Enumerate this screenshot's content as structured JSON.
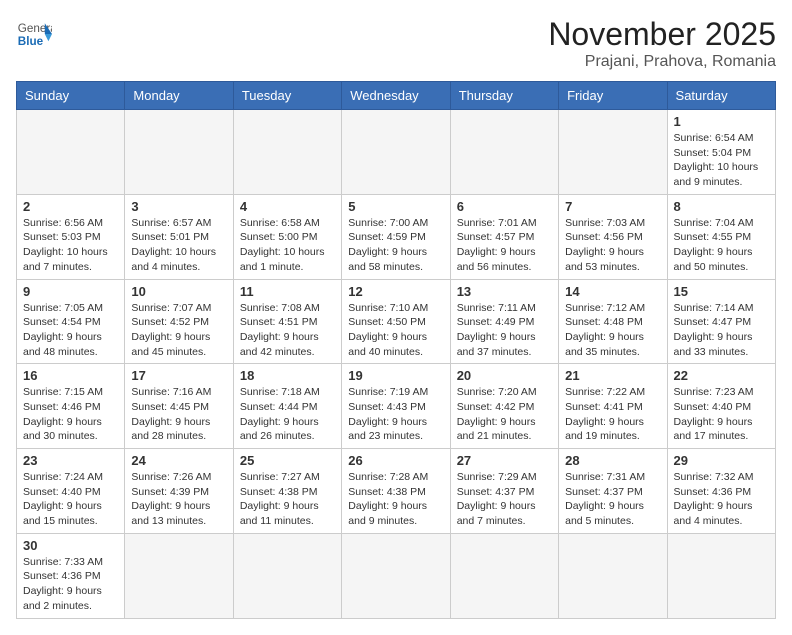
{
  "header": {
    "logo_general": "General",
    "logo_blue": "Blue",
    "month_title": "November 2025",
    "location": "Prajani, Prahova, Romania"
  },
  "weekdays": [
    "Sunday",
    "Monday",
    "Tuesday",
    "Wednesday",
    "Thursday",
    "Friday",
    "Saturday"
  ],
  "weeks": [
    [
      {
        "day": "",
        "info": ""
      },
      {
        "day": "",
        "info": ""
      },
      {
        "day": "",
        "info": ""
      },
      {
        "day": "",
        "info": ""
      },
      {
        "day": "",
        "info": ""
      },
      {
        "day": "",
        "info": ""
      },
      {
        "day": "1",
        "info": "Sunrise: 6:54 AM\nSunset: 5:04 PM\nDaylight: 10 hours and 9 minutes."
      }
    ],
    [
      {
        "day": "2",
        "info": "Sunrise: 6:56 AM\nSunset: 5:03 PM\nDaylight: 10 hours and 7 minutes."
      },
      {
        "day": "3",
        "info": "Sunrise: 6:57 AM\nSunset: 5:01 PM\nDaylight: 10 hours and 4 minutes."
      },
      {
        "day": "4",
        "info": "Sunrise: 6:58 AM\nSunset: 5:00 PM\nDaylight: 10 hours and 1 minute."
      },
      {
        "day": "5",
        "info": "Sunrise: 7:00 AM\nSunset: 4:59 PM\nDaylight: 9 hours and 58 minutes."
      },
      {
        "day": "6",
        "info": "Sunrise: 7:01 AM\nSunset: 4:57 PM\nDaylight: 9 hours and 56 minutes."
      },
      {
        "day": "7",
        "info": "Sunrise: 7:03 AM\nSunset: 4:56 PM\nDaylight: 9 hours and 53 minutes."
      },
      {
        "day": "8",
        "info": "Sunrise: 7:04 AM\nSunset: 4:55 PM\nDaylight: 9 hours and 50 minutes."
      }
    ],
    [
      {
        "day": "9",
        "info": "Sunrise: 7:05 AM\nSunset: 4:54 PM\nDaylight: 9 hours and 48 minutes."
      },
      {
        "day": "10",
        "info": "Sunrise: 7:07 AM\nSunset: 4:52 PM\nDaylight: 9 hours and 45 minutes."
      },
      {
        "day": "11",
        "info": "Sunrise: 7:08 AM\nSunset: 4:51 PM\nDaylight: 9 hours and 42 minutes."
      },
      {
        "day": "12",
        "info": "Sunrise: 7:10 AM\nSunset: 4:50 PM\nDaylight: 9 hours and 40 minutes."
      },
      {
        "day": "13",
        "info": "Sunrise: 7:11 AM\nSunset: 4:49 PM\nDaylight: 9 hours and 37 minutes."
      },
      {
        "day": "14",
        "info": "Sunrise: 7:12 AM\nSunset: 4:48 PM\nDaylight: 9 hours and 35 minutes."
      },
      {
        "day": "15",
        "info": "Sunrise: 7:14 AM\nSunset: 4:47 PM\nDaylight: 9 hours and 33 minutes."
      }
    ],
    [
      {
        "day": "16",
        "info": "Sunrise: 7:15 AM\nSunset: 4:46 PM\nDaylight: 9 hours and 30 minutes."
      },
      {
        "day": "17",
        "info": "Sunrise: 7:16 AM\nSunset: 4:45 PM\nDaylight: 9 hours and 28 minutes."
      },
      {
        "day": "18",
        "info": "Sunrise: 7:18 AM\nSunset: 4:44 PM\nDaylight: 9 hours and 26 minutes."
      },
      {
        "day": "19",
        "info": "Sunrise: 7:19 AM\nSunset: 4:43 PM\nDaylight: 9 hours and 23 minutes."
      },
      {
        "day": "20",
        "info": "Sunrise: 7:20 AM\nSunset: 4:42 PM\nDaylight: 9 hours and 21 minutes."
      },
      {
        "day": "21",
        "info": "Sunrise: 7:22 AM\nSunset: 4:41 PM\nDaylight: 9 hours and 19 minutes."
      },
      {
        "day": "22",
        "info": "Sunrise: 7:23 AM\nSunset: 4:40 PM\nDaylight: 9 hours and 17 minutes."
      }
    ],
    [
      {
        "day": "23",
        "info": "Sunrise: 7:24 AM\nSunset: 4:40 PM\nDaylight: 9 hours and 15 minutes."
      },
      {
        "day": "24",
        "info": "Sunrise: 7:26 AM\nSunset: 4:39 PM\nDaylight: 9 hours and 13 minutes."
      },
      {
        "day": "25",
        "info": "Sunrise: 7:27 AM\nSunset: 4:38 PM\nDaylight: 9 hours and 11 minutes."
      },
      {
        "day": "26",
        "info": "Sunrise: 7:28 AM\nSunset: 4:38 PM\nDaylight: 9 hours and 9 minutes."
      },
      {
        "day": "27",
        "info": "Sunrise: 7:29 AM\nSunset: 4:37 PM\nDaylight: 9 hours and 7 minutes."
      },
      {
        "day": "28",
        "info": "Sunrise: 7:31 AM\nSunset: 4:37 PM\nDaylight: 9 hours and 5 minutes."
      },
      {
        "day": "29",
        "info": "Sunrise: 7:32 AM\nSunset: 4:36 PM\nDaylight: 9 hours and 4 minutes."
      }
    ],
    [
      {
        "day": "30",
        "info": "Sunrise: 7:33 AM\nSunset: 4:36 PM\nDaylight: 9 hours and 2 minutes."
      },
      {
        "day": "",
        "info": ""
      },
      {
        "day": "",
        "info": ""
      },
      {
        "day": "",
        "info": ""
      },
      {
        "day": "",
        "info": ""
      },
      {
        "day": "",
        "info": ""
      },
      {
        "day": "",
        "info": ""
      }
    ]
  ]
}
